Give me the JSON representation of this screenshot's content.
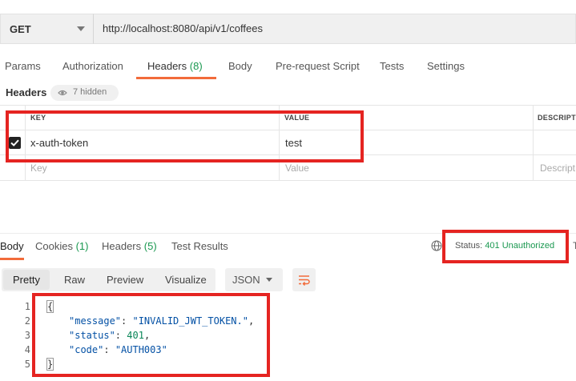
{
  "request": {
    "method": "GET",
    "url": "http://localhost:8080/api/v1/coffees"
  },
  "request_tabs": {
    "params": "Params",
    "authorization": "Authorization",
    "headers": "Headers",
    "headers_count": "(8)",
    "body": "Body",
    "prerequest": "Pre-request Script",
    "tests": "Tests",
    "settings": "Settings"
  },
  "headers_section": {
    "label": "Headers",
    "hidden": "7 hidden"
  },
  "table": {
    "col_key": "KEY",
    "col_value": "VALUE",
    "col_description": "DESCRIPT",
    "rows": [
      {
        "key": "x-auth-token",
        "value": "test",
        "checked": true
      }
    ],
    "placeholder_key": "Key",
    "placeholder_value": "Value",
    "placeholder_description": "Descript"
  },
  "response_tabs": {
    "body": "Body",
    "cookies": "Cookies",
    "cookies_count": "(1)",
    "headers": "Headers",
    "headers_count": "(5)",
    "test_results": "Test Results"
  },
  "status": {
    "label": "Status:",
    "value": "401 Unauthorized",
    "trailing": "T"
  },
  "viewer": {
    "pretty": "Pretty",
    "raw": "Raw",
    "preview": "Preview",
    "visualize": "Visualize",
    "format": "JSON"
  },
  "code": {
    "line_numbers": [
      "1",
      "2",
      "3",
      "4",
      "5"
    ],
    "open": "{",
    "close": "}",
    "message_key": "\"message\"",
    "message_value": "\"INVALID_JWT_TOKEN.\"",
    "status_key": "\"status\"",
    "status_value": "401",
    "code_key": "\"code\"",
    "code_value": "\"AUTH003\""
  },
  "colors": {
    "accent": "#f26b3a",
    "success_green": "#1a9850",
    "annotation_red": "#e52421"
  },
  "icons": [
    "chevron-down-icon",
    "eye-icon",
    "check-icon",
    "globe-icon",
    "wrap-icon"
  ]
}
